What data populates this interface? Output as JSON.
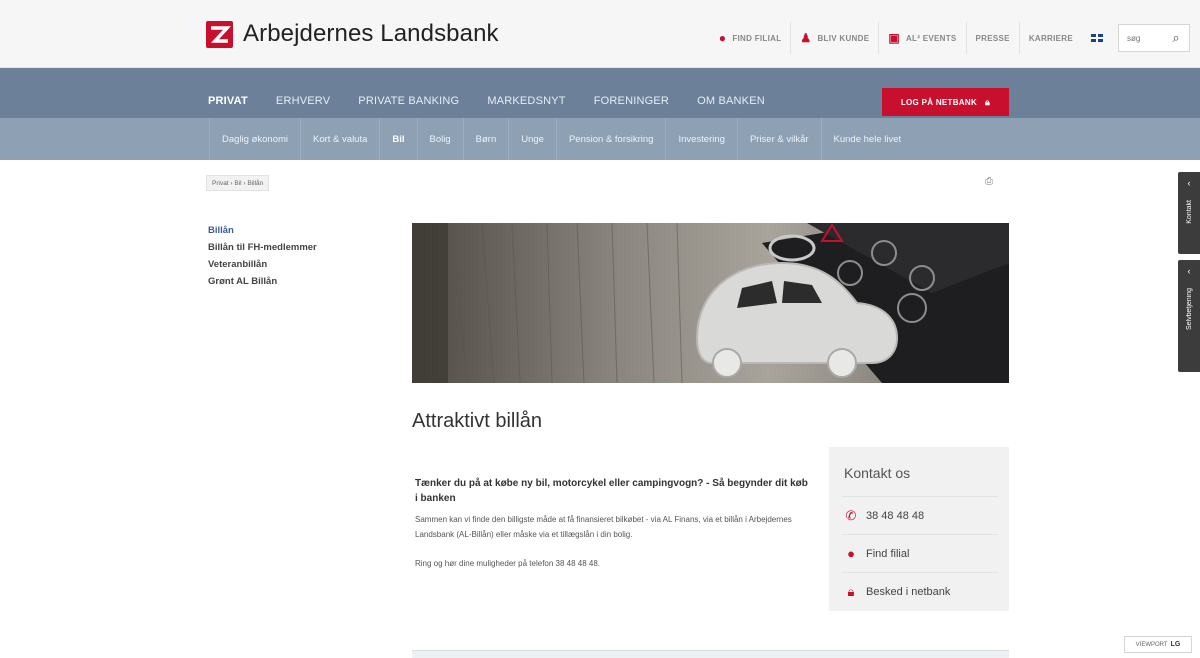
{
  "brand": {
    "name": "Arbejdernes Landsbank",
    "color": "#c8102e"
  },
  "utility": {
    "find_filial": "FIND FILIAL",
    "bliv_kunde": "BLIV KUNDE",
    "events": "AL² EVENTS",
    "presse": "PRESSE",
    "karriere": "KARRIERE",
    "search_placeholder": "søg"
  },
  "mainnav": {
    "items": [
      "PRIVAT",
      "ERHVERV",
      "PRIVATE BANKING",
      "MARKEDSNYT",
      "FORENINGER",
      "OM BANKEN"
    ],
    "login": "LOG PÅ NETBANK"
  },
  "subnav": {
    "items": [
      "Daglig økonomi",
      "Kort & valuta",
      "Bil",
      "Bolig",
      "Børn",
      "Unge",
      "Pension & forsikring",
      "Investering",
      "Priser & vilkår",
      "Kunde hele livet"
    ]
  },
  "breadcrumb": "Privat  ›  Bil  ›  Billån",
  "sidenav": {
    "items": [
      "Billån",
      "Billån til FH-medlemmer",
      "Veteranbillån",
      "Grønt AL Billån"
    ]
  },
  "content": {
    "title": "Attraktivt billån",
    "lead": "Tænker du på at købe ny bil, motorcykel eller campingvogn? - Så begynder dit køb i banken",
    "para1": "Sammen kan vi finde den billigste måde at få finansieret bilkøbet - via AL Finans, via et billån i Arbejdernes Landsbank (AL-Billån) eller måske via et tillægslån i din bolig.",
    "para2": "Ring og hør dine muligheder på telefon 38 48 48 48."
  },
  "contact": {
    "title": "Kontakt os",
    "phone": "38 48 48 48",
    "find_filial": "Find filial",
    "message": "Besked i netbank"
  },
  "side_tabs": {
    "kontakt": "Kontakt",
    "selvbetjening": "Selvbetjening"
  },
  "viewport": {
    "label": "VIEWPORT",
    "size": "LG"
  }
}
